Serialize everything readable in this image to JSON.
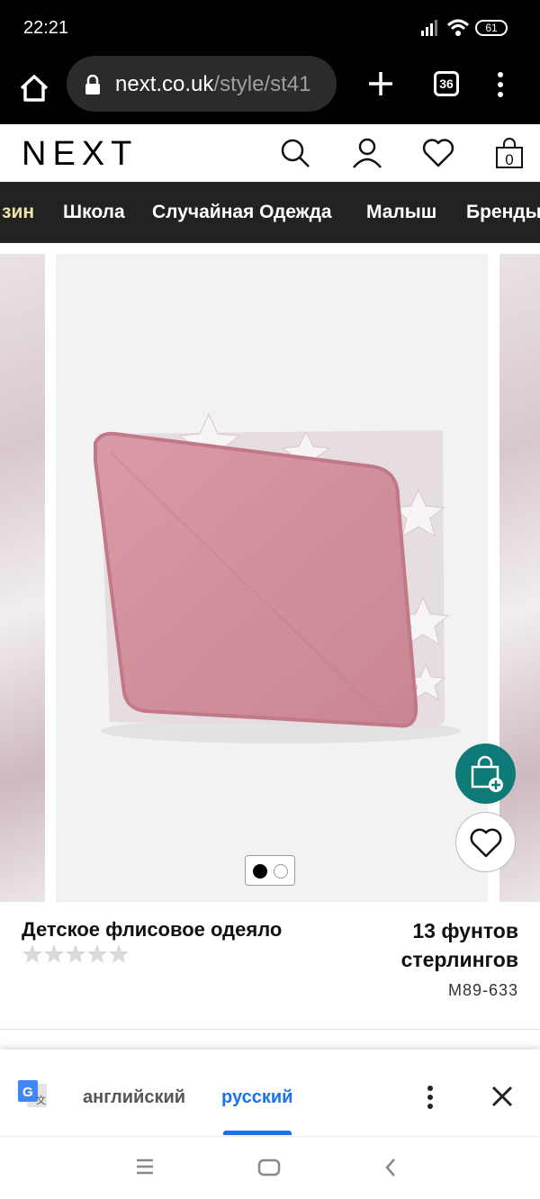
{
  "status_bar": {
    "time": "22:21",
    "battery": "61"
  },
  "browser": {
    "url_domain": "next.co.uk",
    "url_path": "/style/st41",
    "tab_count": "36"
  },
  "site": {
    "logo": "NEXT",
    "basket_count": "0"
  },
  "categories": [
    {
      "label": "зин"
    },
    {
      "label": "Школа"
    },
    {
      "label": "Случайная Одежда"
    },
    {
      "label": "Малыш"
    },
    {
      "label": "Бренды"
    }
  ],
  "product": {
    "title": "Детское флисовое одеяло",
    "price_line1": "13 фунтов",
    "price_line2": "стерлингов",
    "sku": "M89-633",
    "rating_stars": 0,
    "rating_max": 5,
    "image_count": 2,
    "image_active": 1
  },
  "translate_bar": {
    "source_lang": "английский",
    "target_lang": "русский"
  },
  "colors": {
    "accent_teal": "#0f7b78",
    "translate_blue": "#1a73e8",
    "nav_bg": "#222222",
    "blanket_pink": "#d79aa6"
  }
}
